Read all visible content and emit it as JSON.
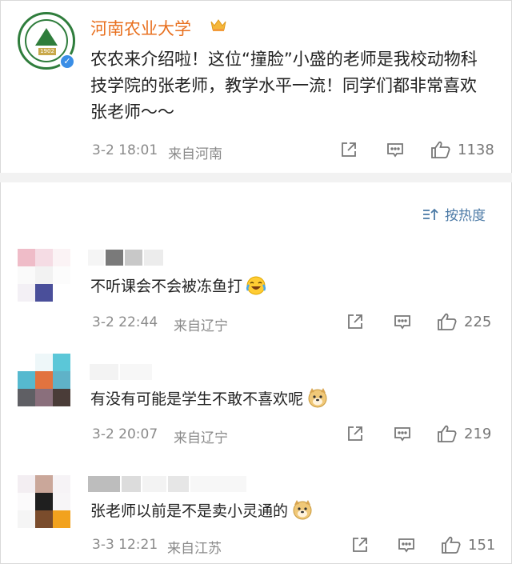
{
  "post": {
    "author": "河南农业大学",
    "logo_text": "1902",
    "text": "农农来介绍啦！这位“撞脸”小盛的老师是我校动物科技学院的张老师，教学水平一流！同学们都非常喜欢张老师～～",
    "time": "3-2 18:01",
    "location": "来自河南",
    "like_count": "1138"
  },
  "sort": {
    "label": "按热度"
  },
  "comments": [
    {
      "text": "不听课会不会被冻鱼打",
      "emoji": "laugh-cry-emoji",
      "time": "3-2 22:44",
      "location": "来自辽宁",
      "like_count": "225"
    },
    {
      "text": "有没有可能是学生不敢不喜欢呢",
      "emoji": "doge-emoji",
      "time": "3-2 20:07",
      "location": "来自辽宁",
      "like_count": "219"
    },
    {
      "text": "张老师以前是不是卖小灵通的",
      "emoji": "doge-emoji",
      "time": "3-3 12:21",
      "location": "来自江苏",
      "like_count": "151"
    }
  ],
  "colors": {
    "author": "#e8701f",
    "meta": "#8a8a8a",
    "sort": "#4c7aa6",
    "verify": "#3a8ee6"
  }
}
